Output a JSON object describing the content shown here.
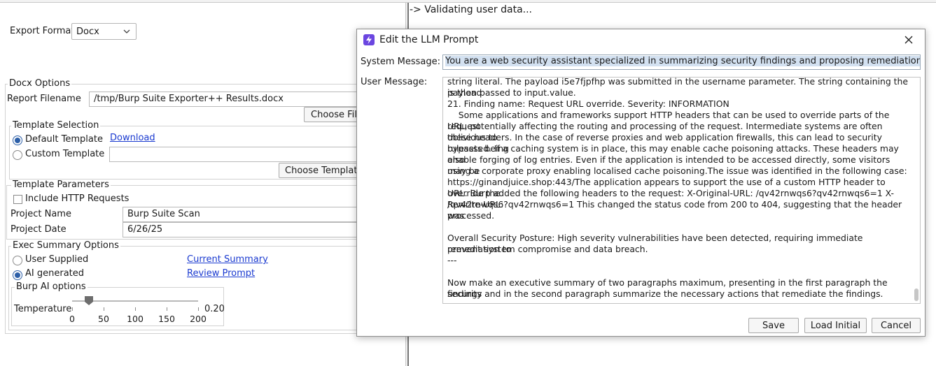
{
  "console": {
    "text": "-> Validating user data..."
  },
  "export": {
    "label": "Export Format",
    "value": "Docx"
  },
  "docx_options": {
    "title": "Docx Options",
    "filename_label": "Report Filename",
    "filename_value": "/tmp/Burp Suite Exporter++ Results.docx",
    "choose_file": "Choose File"
  },
  "template_selection": {
    "title": "Template Selection",
    "default_label": "Default Template",
    "download_link": "Download",
    "custom_label": "Custom Template",
    "choose_template": "Choose Template"
  },
  "template_params": {
    "title": "Template Parameters",
    "include_http": "Include HTTP Requests",
    "project_name_label": "Project Name",
    "project_name_value": "Burp Suite Scan",
    "project_date_label": "Project Date",
    "project_date_value": "6/26/25"
  },
  "exec_summary": {
    "title": "Exec Summary Options",
    "user_supplied": "User Supplied",
    "current_summary": "Current Summary",
    "ai_generated": "AI generated",
    "review_prompt": "Review Prompt"
  },
  "burp_ai": {
    "title": "Burp AI options",
    "temperature_label": "Temperature",
    "temperature_value": "0.20",
    "ticks": [
      "0",
      "50",
      "100",
      "150",
      "200"
    ],
    "slider_value": 20,
    "slider_max": 200
  },
  "dialog": {
    "title": "Edit the LLM Prompt",
    "system_label": "System Message:",
    "system_value": "You are a web security assistant specialized in summarizing security findings and proposing remediation actions.",
    "user_label": "User Message:",
    "user_lines": [
      "string literal. The payload i5e7fjpfhp was submitted in the username parameter. The string containing the payload",
      "is then passed to input.value.",
      "21. Finding name: Request URL override. Severity: INFORMATION",
      "    Some applications and frameworks support HTTP headers that can be used to override parts of the request",
      "URL, potentially affecting the routing and processing of the request. Intermediate systems are often oblivious to",
      "these headers. In the case of reverse proxies and web application firewalls, this can lead to security rulesets being",
      "bypassed. If a caching system is in place, this may enable cache poisoning attacks. These headers may also",
      "enable forging of log entries. Even if the application is intended to be accessed directly, some visitors may be",
      "using a corporate proxy enabling localised cache poisoning.The issue was identified in the following case:",
      "https://ginandjuice.shop:443/The application appears to support the use of a custom HTTP header to override the",
      "URL. Burp added the following headers to the request: X-Original-URL: /qv42rnwqs6?qv42rnwqs6=1 X-Rewrite-URL:",
      "/qv42rnwqs6?qv42rnwqs6=1 This changed the status code from 200 to 404, suggesting that the header was",
      "processed.",
      "",
      "Overall Security Posture: High severity vulnerabilities have been detected, requiring immediate remediation to",
      "prevent system compromise and data breach.",
      "---",
      "",
      "Now make an executive summary of two paragraphs maximum, presenting in the first paragraph the security",
      "findings and in the second paragraph summarize the necessary actions that remediate the findings."
    ],
    "save": "Save",
    "load_initial": "Load Initial",
    "cancel": "Cancel"
  },
  "colors": {
    "accent": "#2c5fa8",
    "link": "#1a3ad0",
    "icon": "#6b46e0",
    "selection": "#d3e1f1"
  }
}
